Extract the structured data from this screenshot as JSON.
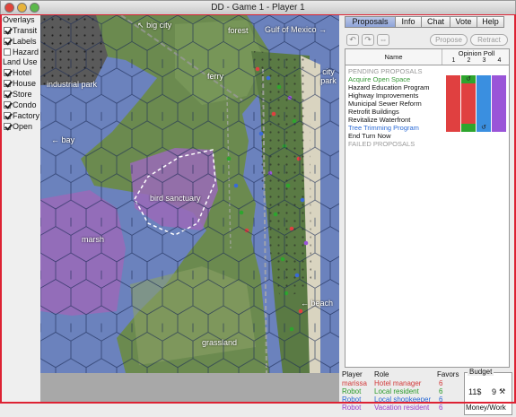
{
  "window": {
    "title": "DD - Game 1 - Player 1"
  },
  "overlays": {
    "title": "Overlays",
    "items": [
      {
        "label": "Transit",
        "checked": true
      },
      {
        "label": "Labels",
        "checked": true
      },
      {
        "label": "Hazard",
        "checked": false
      }
    ]
  },
  "land_use": {
    "title": "Land Use",
    "items": [
      {
        "label": "Hotel",
        "checked": true
      },
      {
        "label": "House",
        "checked": true
      },
      {
        "label": "Store",
        "checked": true
      },
      {
        "label": "Condo",
        "checked": true
      },
      {
        "label": "Factory",
        "checked": true
      },
      {
        "label": "Open",
        "checked": true
      }
    ]
  },
  "map": {
    "labels": {
      "big_city": "big city",
      "forest": "forest",
      "gulf": "Gulf of Mexico",
      "industrial_park": "industrial park",
      "ferry": "ferry",
      "city_park": "city park",
      "bay": "bay",
      "bird_sanctuary": "bird sanctuary",
      "marsh": "marsh",
      "beach": "beach",
      "grassland": "grassland"
    },
    "arrows": {
      "left": "←",
      "right": "→",
      "up_left": "↖"
    }
  },
  "tabs": [
    "Proposals",
    "Info",
    "Chat",
    "Vote",
    "Help"
  ],
  "toolbar": {
    "propose": "Propose",
    "retract": "Retract"
  },
  "proposals": {
    "col_name": "Name",
    "col_poll": "Opinion Poll",
    "poll_cols": [
      "1",
      "2",
      "3",
      "4"
    ],
    "pending_header": "PENDING PROPOSALS",
    "failed_header": "FAILED PROPOSALS",
    "rows": [
      {
        "name": "Acquire Open Space",
        "color": "#3a9a3a",
        "poll": [
          "",
          "↺",
          "",
          ""
        ]
      },
      {
        "name": "Hazard Education Program",
        "color": "#111111",
        "poll": [
          "",
          "",
          "",
          ""
        ]
      },
      {
        "name": "Highway Improvements",
        "color": "#111111",
        "poll": [
          "",
          "",
          "",
          ""
        ]
      },
      {
        "name": "Municipal Sewer Reform",
        "color": "#111111",
        "poll": [
          "",
          "",
          "",
          ""
        ]
      },
      {
        "name": "Retrofit Buildings",
        "color": "#111111",
        "poll": [
          "",
          "",
          "",
          ""
        ]
      },
      {
        "name": "Revitalize Waterfront",
        "color": "#111111",
        "poll": [
          "",
          "",
          "",
          ""
        ]
      },
      {
        "name": "Tree Trimming Program",
        "color": "#2a6ad6",
        "poll": [
          "",
          "",
          "↺",
          ""
        ]
      },
      {
        "name": "End Turn Now",
        "color": "#111111",
        "poll": null
      }
    ],
    "poll_colors": [
      [
        "#e04040",
        "#2ea52e",
        "#3a8fe0",
        "#9a55d8"
      ],
      [
        "#e04040",
        "#e04040",
        "#3a8fe0",
        "#9a55d8"
      ],
      [
        "#e04040",
        "#e04040",
        "#3a8fe0",
        "#9a55d8"
      ],
      [
        "#e04040",
        "#e04040",
        "#3a8fe0",
        "#9a55d8"
      ],
      [
        "#e04040",
        "#e04040",
        "#3a8fe0",
        "#9a55d8"
      ],
      [
        "#e04040",
        "#e04040",
        "#3a8fe0",
        "#9a55d8"
      ],
      [
        "#e04040",
        "#2ea52e",
        "#3a8fe0",
        "#9a55d8"
      ]
    ]
  },
  "players": {
    "headers": {
      "player": "Player",
      "role": "Role",
      "favors": "Favors"
    },
    "rows": [
      {
        "player": "marissa",
        "role": "Hotel manager",
        "favors": "6",
        "color": "#d23a3a"
      },
      {
        "player": "Robot",
        "role": "Local resident",
        "favors": "6",
        "color": "#2a9a2a"
      },
      {
        "player": "Robot",
        "role": "Local shopkeeper",
        "favors": "6",
        "color": "#2a6ad6"
      },
      {
        "player": "Robot",
        "role": "Vacation resident",
        "favors": "6",
        "color": "#9a40cc"
      }
    ]
  },
  "budget": {
    "title": "Budget",
    "money": "11$",
    "work": "9",
    "footer": "Money/Work"
  }
}
